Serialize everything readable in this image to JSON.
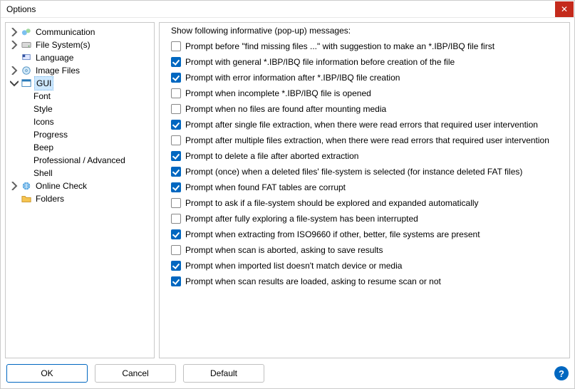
{
  "window": {
    "title": "Options"
  },
  "tree": {
    "items": [
      {
        "label": "Communication",
        "icon": "comm"
      },
      {
        "label": "File System(s)",
        "icon": "fs"
      },
      {
        "label": "Language",
        "icon": "lang"
      },
      {
        "label": "Image Files",
        "icon": "img"
      },
      {
        "label": "GUI",
        "icon": "gui"
      },
      {
        "label": "Online Check",
        "icon": "online"
      },
      {
        "label": "Folders",
        "icon": "folder"
      }
    ],
    "gui_children": [
      {
        "label": "Font"
      },
      {
        "label": "Style"
      },
      {
        "label": "Icons"
      },
      {
        "label": "Progress"
      },
      {
        "label": "Beep"
      },
      {
        "label": "Professional / Advanced"
      },
      {
        "label": "Shell"
      }
    ]
  },
  "group": {
    "legend": "Show following informative (pop-up) messages:"
  },
  "checks": [
    {
      "checked": false,
      "label": "Prompt before \"find missing files ...\" with suggestion to make an *.IBP/IBQ file first"
    },
    {
      "checked": true,
      "label": "Prompt with general *.IBP/IBQ file information before creation of the file"
    },
    {
      "checked": true,
      "label": "Prompt with error information after *.IBP/IBQ file creation"
    },
    {
      "checked": false,
      "label": "Prompt when incomplete *.IBP/IBQ file is opened"
    },
    {
      "checked": false,
      "label": "Prompt when no files are found after mounting media"
    },
    {
      "checked": true,
      "label": "Prompt after single file extraction, when there were read errors that required user intervention"
    },
    {
      "checked": false,
      "label": "Prompt after multiple files extraction, when there were read errors that required user intervention"
    },
    {
      "checked": true,
      "label": "Prompt to delete a file after aborted extraction"
    },
    {
      "checked": true,
      "label": "Prompt (once) when a deleted files' file-system is selected (for instance deleted FAT files)"
    },
    {
      "checked": true,
      "label": "Prompt when found FAT tables are corrupt"
    },
    {
      "checked": false,
      "label": "Prompt to ask if a file-system should be explored and expanded automatically"
    },
    {
      "checked": false,
      "label": "Prompt after fully exploring a file-system has been interrupted"
    },
    {
      "checked": true,
      "label": "Prompt when extracting from ISO9660 if other, better, file systems are present"
    },
    {
      "checked": false,
      "label": "Prompt when scan is aborted, asking to save results"
    },
    {
      "checked": true,
      "label": "Prompt when imported list doesn't match device or media"
    },
    {
      "checked": true,
      "label": "Prompt when scan results are loaded, asking to resume scan or not"
    }
  ],
  "buttons": {
    "ok": "OK",
    "cancel": "Cancel",
    "default": "Default"
  }
}
